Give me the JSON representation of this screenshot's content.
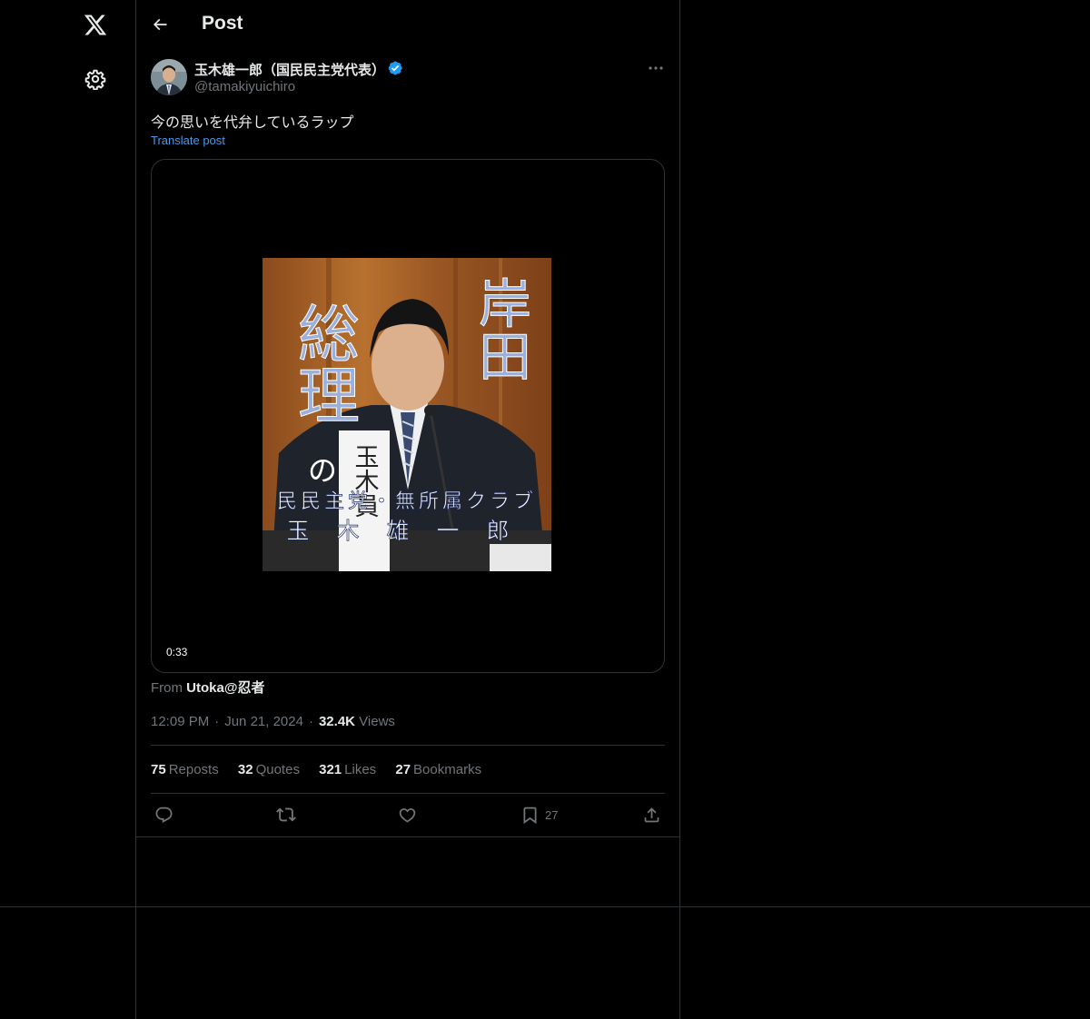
{
  "header": {
    "title": "Post"
  },
  "author": {
    "name": "玉木雄一郎（国民民主党代表）",
    "handle": "@tamakiyuichiro",
    "verified": true
  },
  "post": {
    "text": "今の思いを代弁しているラップ",
    "translate_label": "Translate post"
  },
  "video": {
    "duration": "0:33",
    "overlay_text": {
      "top_right": "岸田",
      "left": "総理",
      "left_small": "の",
      "caption_line1": "民民主党・無所属クラブ",
      "caption_line2": "玉木雄一郎",
      "nameplate": "玉木員"
    }
  },
  "source": {
    "prefix": "From",
    "account": "Utoka@忍者"
  },
  "meta": {
    "time": "12:09 PM",
    "date": "Jun 21, 2024",
    "views_count": "32.4K",
    "views_label": "Views"
  },
  "stats": {
    "reposts_count": "75",
    "reposts_label": "Reposts",
    "quotes_count": "32",
    "quotes_label": "Quotes",
    "likes_count": "321",
    "likes_label": "Likes",
    "bookmarks_count": "27",
    "bookmarks_label": "Bookmarks"
  },
  "actions": {
    "bookmark_count": "27"
  },
  "icons": [
    "x-logo-icon",
    "settings-icon",
    "back-arrow-icon",
    "verified-badge-icon",
    "more-icon",
    "reply-icon",
    "repost-icon",
    "like-icon",
    "bookmark-icon",
    "share-icon"
  ],
  "colors": {
    "background": "#000000",
    "text": "#e7e9ea",
    "muted": "#71767b",
    "link": "#4a99e9",
    "verified": "#1d9bf0",
    "border": "#2f3336"
  }
}
